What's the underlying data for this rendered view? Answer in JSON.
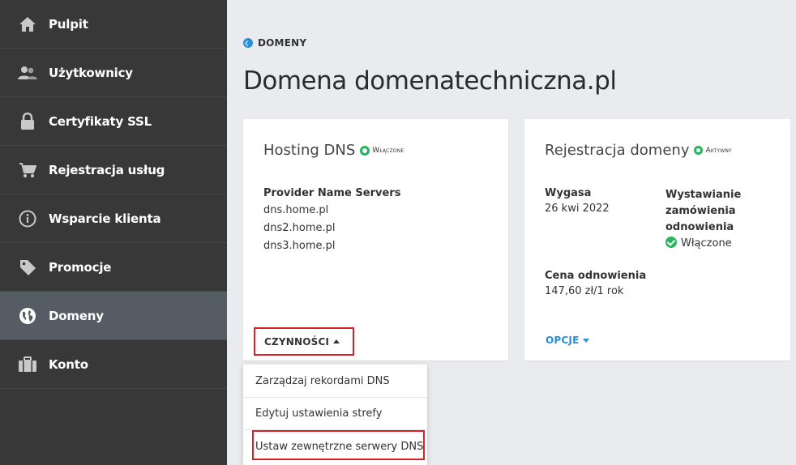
{
  "sidebar": {
    "items": [
      {
        "label": "Pulpit",
        "icon": "home-icon"
      },
      {
        "label": "Użytkownicy",
        "icon": "users-icon"
      },
      {
        "label": "Certyfikaty SSL",
        "icon": "lock-icon"
      },
      {
        "label": "Rejestracja usług",
        "icon": "cart-icon"
      },
      {
        "label": "Wsparcie klienta",
        "icon": "info-icon"
      },
      {
        "label": "Promocje",
        "icon": "tag-icon"
      },
      {
        "label": "Domeny",
        "icon": "globe-icon",
        "active": true
      },
      {
        "label": "Konto",
        "icon": "briefcase-icon"
      }
    ]
  },
  "breadcrumb": {
    "label": "DOMENY",
    "icon": "back-arrow-icon"
  },
  "page_title": "Domena domenatechniczna.pl",
  "dns_card": {
    "title": "Hosting DNS",
    "status": "Włączone",
    "servers_heading": "Provider Name Servers",
    "servers": [
      "dns.home.pl",
      "dns2.home.pl",
      "dns3.home.pl"
    ],
    "actions_label": "CZYNNOŚCI"
  },
  "registration_card": {
    "title": "Rejestracja domeny",
    "status": "Aktywny",
    "expires_label": "Wygasa",
    "expires_value": "26 kwi 2022",
    "renewal_label_1": "Wystawianie",
    "renewal_label_2": "zamówienia",
    "renewal_label_3": "odnowienia",
    "renewal_value": "Włączone",
    "price_label": "Cena odnowienia",
    "price_value": "147,60 zł/1 rok",
    "options_label": "OPCJE"
  },
  "dropdown": {
    "items": [
      "Zarządzaj rekordami DNS",
      "Edytuj ustawienia strefy",
      "Ustaw zewnętrzne serwery DNS"
    ]
  },
  "colors": {
    "sidebar_bg": "#383838",
    "sidebar_active": "#555c64",
    "accent_blue": "#2a8fd8",
    "status_green": "#28b45a",
    "highlight_red": "#dc1f26"
  }
}
